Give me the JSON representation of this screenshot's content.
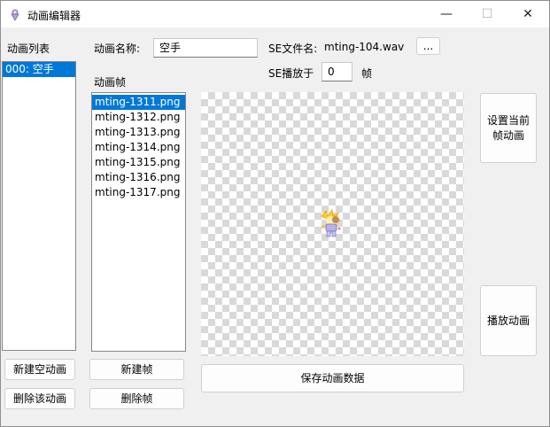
{
  "window": {
    "title": "动画编辑器",
    "controls": {
      "minimize": "—",
      "maximize": "☐",
      "close": "✕"
    }
  },
  "left_panel": {
    "label": "动画列表",
    "items": [
      "000: 空手"
    ],
    "selected_index": 0,
    "new_button": "新建空动画",
    "delete_button": "删除该动画"
  },
  "animation": {
    "name_label": "动画名称:",
    "name_value": "空手",
    "se_file_label": "SE文件名:",
    "se_file_value": "mting-104.wav",
    "browse_button": "...",
    "se_play_label": "SE播放于",
    "se_play_value": "0",
    "se_play_unit": "帧"
  },
  "frames": {
    "label": "动画帧",
    "items": [
      "mting-1311.png",
      "mting-1312.png",
      "mting-1313.png",
      "mting-1314.png",
      "mting-1315.png",
      "mting-1316.png",
      "mting-1317.png"
    ],
    "selected_index": 0,
    "new_button": "新建帧",
    "delete_button": "删除帧"
  },
  "actions": {
    "set_current_button_line1": "设置当前",
    "set_current_button_line2": "帧动画",
    "play_button": "播放动画",
    "save_button": "保存动画数据"
  },
  "colors": {
    "selection": "#0078d7",
    "checker": "#d9d9d9",
    "window_bg": "#f0f0f0"
  }
}
